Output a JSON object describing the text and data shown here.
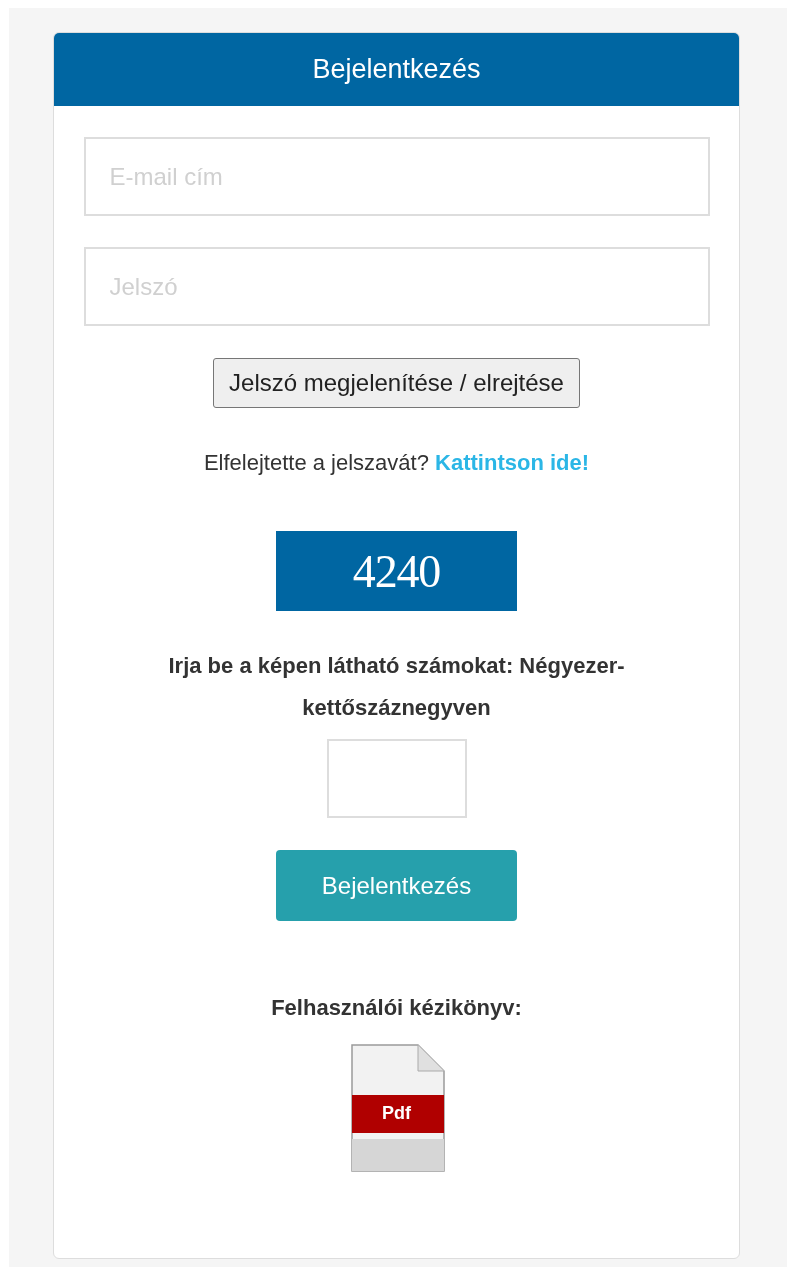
{
  "card": {
    "title": "Bejelentkezés"
  },
  "fields": [
    {
      "placeholder": "E-mail cím"
    },
    {
      "placeholder": "Jelszó"
    }
  ],
  "toggle_button": "Jelszó megjelenítése / elrejtése",
  "forgot": {
    "text": "Elfelejtette a jelszavát?",
    "link": "Kattintson ide!"
  },
  "captcha": {
    "text": "4240",
    "prompt": "Irja be a képen látható számokat: Négyezer-kettőszáznegyven"
  },
  "login_button": "Bejelentkezés",
  "manual": {
    "label": "Felhasználói kézikönyv:",
    "icon_text": "Pdf"
  }
}
